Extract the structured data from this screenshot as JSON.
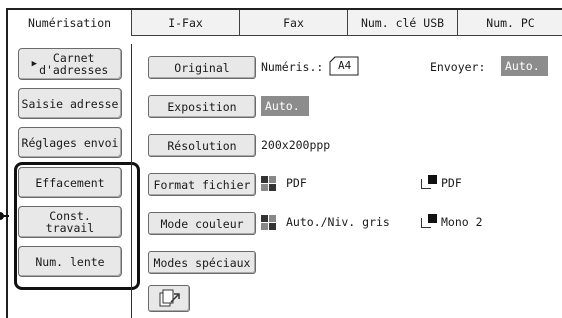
{
  "tabs": [
    {
      "label": "Numérisation",
      "active": true
    },
    {
      "label": "I-Fax",
      "active": false
    },
    {
      "label": "Fax",
      "active": false
    },
    {
      "label": "Num. clé USB",
      "active": false
    },
    {
      "label": "Num. PC",
      "active": false
    }
  ],
  "left_buttons": {
    "address_book": {
      "line1": "Carnet",
      "line2": "d'adresses"
    },
    "address_entry": "Saisie adresse",
    "send_settings": "Réglages envoi",
    "clear": "Effacement",
    "job_build": {
      "line1": "Const.",
      "line2": "travail"
    },
    "slow_scan": "Num. lente"
  },
  "settings": {
    "original": {
      "label": "Original",
      "scan_label": "Numéris.:",
      "paper": "A4",
      "send_label": "Envoyer:",
      "send_value": "Auto."
    },
    "exposure": {
      "label": "Exposition",
      "value": "Auto."
    },
    "resolution": {
      "label": "Résolution",
      "value": "200x200ppp"
    },
    "file_format": {
      "label": "Format fichier",
      "color_value": "PDF",
      "mono_value": "PDF"
    },
    "color_mode": {
      "label": "Mode couleur",
      "color_value": "Auto./Niv. gris",
      "mono_value": "Mono 2"
    },
    "special_modes": {
      "label": "Modes spéciaux"
    }
  },
  "icons": {
    "color_grid": "color-grid-icon",
    "mono": "mono-page-icon",
    "scan_to": "scan-document-icon"
  },
  "colors": {
    "highlight_box": "#8c8c8c",
    "button_face": "#e8e8e8"
  }
}
